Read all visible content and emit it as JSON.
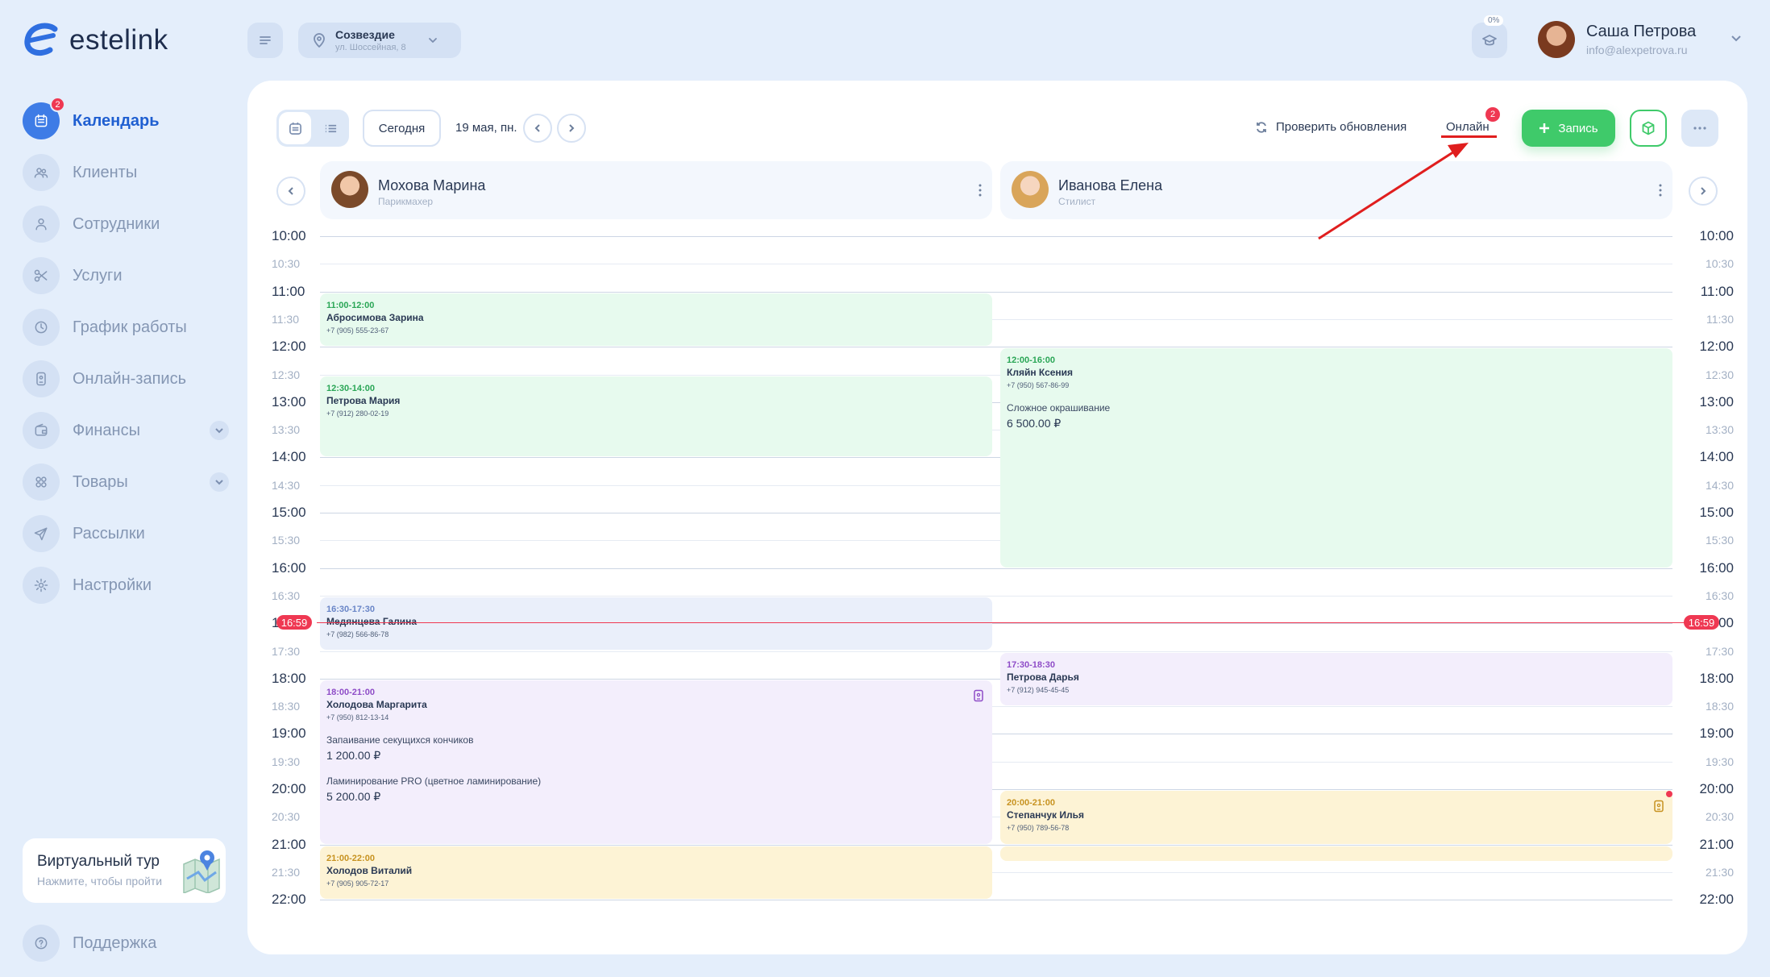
{
  "app": {
    "name": "estelink"
  },
  "sidebar": {
    "items": [
      {
        "label": "Календарь",
        "icon": "calendar-icon",
        "active": true,
        "badge": "2"
      },
      {
        "label": "Клиенты",
        "icon": "clients-icon"
      },
      {
        "label": "Сотрудники",
        "icon": "employee-icon"
      },
      {
        "label": "Услуги",
        "icon": "scissors-icon"
      },
      {
        "label": "График работы",
        "icon": "clock-icon"
      },
      {
        "label": "Онлайн-запись",
        "icon": "online-booking-icon"
      },
      {
        "label": "Финансы",
        "icon": "wallet-icon",
        "expandable": true
      },
      {
        "label": "Товары",
        "icon": "products-icon",
        "expandable": true
      },
      {
        "label": "Рассылки",
        "icon": "send-icon"
      },
      {
        "label": "Настройки",
        "icon": "gear-icon"
      }
    ],
    "tour": {
      "title": "Виртуальный тур",
      "subtitle": "Нажмите, чтобы пройти"
    },
    "support": {
      "label": "Поддержка"
    }
  },
  "topbar": {
    "branch": {
      "name": "Созвездие",
      "address": "ул. Шоссейная, 8"
    },
    "progress_label": "0%",
    "user": {
      "name": "Саша Петрова",
      "email": "info@alexpetrova.ru"
    }
  },
  "toolbar": {
    "today": "Сегодня",
    "date": "19 мая, пн.",
    "check_updates": "Проверить обновления",
    "online": "Онлайн",
    "online_badge": "2",
    "add": "Запись"
  },
  "staff": [
    {
      "name": "Мохова Марина",
      "role": "Парикмахер"
    },
    {
      "name": "Иванова Елена",
      "role": "Стилист"
    }
  ],
  "times": [
    {
      "label": "10:00",
      "hour": true
    },
    {
      "label": "10:30",
      "hour": false
    },
    {
      "label": "11:00",
      "hour": true
    },
    {
      "label": "11:30",
      "hour": false
    },
    {
      "label": "12:00",
      "hour": true
    },
    {
      "label": "12:30",
      "hour": false
    },
    {
      "label": "13:00",
      "hour": true
    },
    {
      "label": "13:30",
      "hour": false
    },
    {
      "label": "14:00",
      "hour": true
    },
    {
      "label": "14:30",
      "hour": false
    },
    {
      "label": "15:00",
      "hour": true
    },
    {
      "label": "15:30",
      "hour": false
    },
    {
      "label": "16:00",
      "hour": true
    },
    {
      "label": "16:30",
      "hour": false
    },
    {
      "label": "17:00",
      "hour": true
    },
    {
      "label": "17:30",
      "hour": false
    },
    {
      "label": "18:00",
      "hour": true
    },
    {
      "label": "18:30",
      "hour": false
    },
    {
      "label": "19:00",
      "hour": true
    },
    {
      "label": "19:30",
      "hour": false
    },
    {
      "label": "20:00",
      "hour": true
    },
    {
      "label": "20:30",
      "hour": false
    },
    {
      "label": "21:00",
      "hour": true
    },
    {
      "label": "21:30",
      "hour": false
    },
    {
      "label": "22:00",
      "hour": true
    }
  ],
  "now": {
    "label": "16:59",
    "minutes": 1019
  },
  "appointments": [
    {
      "col": 0,
      "start": 660,
      "end": 720,
      "time": "11:00-12:00",
      "name": "Абросимова Зарина",
      "phone": "+7 (905) 555-23-67",
      "color": "green",
      "services": []
    },
    {
      "col": 0,
      "start": 750,
      "end": 840,
      "time": "12:30-14:00",
      "name": "Петрова Мария",
      "phone": "+7 (912) 280-02-19",
      "color": "green",
      "services": []
    },
    {
      "col": 0,
      "start": 990,
      "end": 1050,
      "time": "16:30-17:30",
      "name": "Медянцева Галина",
      "phone": "+7 (982) 566-86-78",
      "color": "blue",
      "services": []
    },
    {
      "col": 0,
      "start": 1080,
      "end": 1260,
      "time": "18:00-21:00",
      "name": "Холодова Маргарита",
      "phone": "+7 (950) 812-13-14",
      "color": "purple",
      "icon": true,
      "services": [
        {
          "name": "Запаивание секущихся кончиков",
          "price": "1 200.00 ₽"
        },
        {
          "name": "Ламинирование PRO (цветное ламинирование)",
          "price": "5 200.00 ₽"
        }
      ]
    },
    {
      "col": 0,
      "start": 1260,
      "end": 1320,
      "time": "21:00-22:00",
      "name": "Холодов Виталий",
      "phone": "+7 (905) 905-72-17",
      "color": "yellow",
      "services": []
    },
    {
      "col": 1,
      "start": 720,
      "end": 960,
      "time": "12:00-16:00",
      "name": "Кляйн Ксения",
      "phone": "+7 (950) 567-86-99",
      "color": "green",
      "services": [
        {
          "name": "Сложное окрашивание",
          "price": "6 500.00 ₽"
        }
      ]
    },
    {
      "col": 1,
      "start": 1050,
      "end": 1110,
      "time": "17:30-18:30",
      "name": "Петрова Дарья",
      "phone": "+7 (912) 945-45-45",
      "color": "purple",
      "services": []
    },
    {
      "col": 1,
      "start": 1200,
      "end": 1260,
      "time": "20:00-21:00",
      "name": "Степанчук Илья",
      "phone": "+7 (950) 789-56-78",
      "color": "yellow",
      "icon": true,
      "dot": true,
      "services": []
    },
    {
      "col": 1,
      "start": 1260,
      "end": 1275,
      "time": "",
      "name": "",
      "phone": "",
      "color": "yellow",
      "services": []
    }
  ]
}
